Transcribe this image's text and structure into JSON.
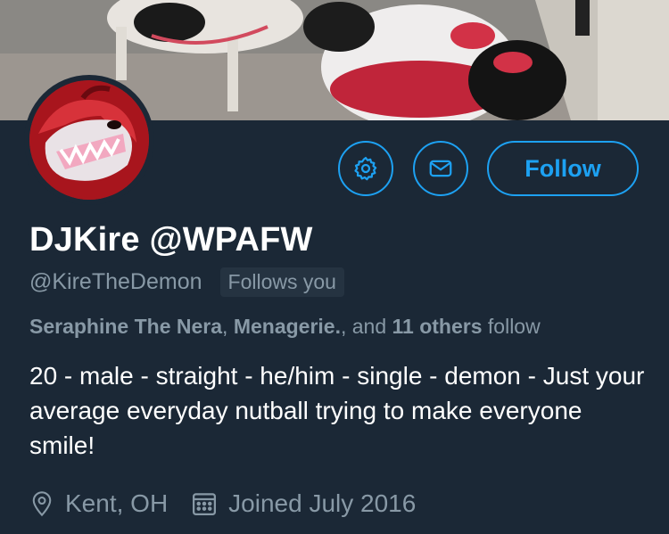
{
  "profile": {
    "display_name": "DJKire @WPAFW",
    "handle": "@KireTheDemon",
    "follows_you_badge": "Follows you",
    "followed_by": {
      "name1": "Seraphine The Nera",
      "sep1": ", ",
      "name2": "Menagerie.",
      "sep2": ", and ",
      "others": "11 others",
      "suffix": " follow"
    },
    "bio": "20 - male - straight - he/him - single - demon - Just your average everyday nutball trying to make everyone smile!",
    "location": "Kent, OH",
    "joined": "Joined July 2016"
  },
  "actions": {
    "follow_label": "Follow",
    "settings_icon": "gear-icon",
    "message_icon": "envelope-icon"
  },
  "colors": {
    "background": "#1b2836",
    "accent": "#1da1f2",
    "secondary_text": "#8899a6"
  }
}
